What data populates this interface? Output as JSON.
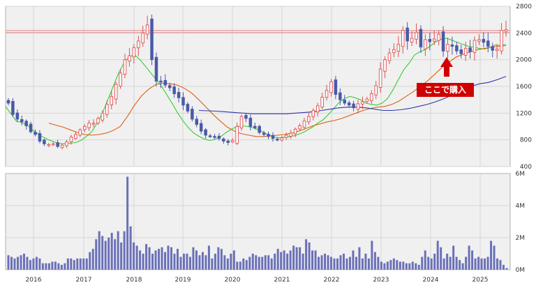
{
  "chart_data": {
    "type": "candlestick",
    "price_panel": {
      "ylim": [
        400,
        2800
      ],
      "y_ticks": [
        "2800",
        "2400",
        "2000",
        "1600",
        "1200",
        "800",
        "400"
      ],
      "x_ticks": [
        "2016",
        "2017",
        "2018",
        "2019",
        "2020",
        "2021",
        "2022",
        "2023",
        "2024",
        "2025"
      ],
      "reference_line": 2420,
      "annotation": "ここで購入",
      "colors": {
        "up": "#e05050",
        "down": "#4a5aa8",
        "ma_short": "#33cc33",
        "ma_mid": "#e06010",
        "ma_long": "#3333aa",
        "ref": "#e08080",
        "annotation_bg": "#d00000"
      },
      "series": {
        "close": [
          1350,
          1180,
          1110,
          1070,
          1010,
          920,
          880,
          780,
          740,
          730,
          740,
          700,
          720,
          770,
          840,
          880,
          950,
          1000,
          1050,
          1050,
          1120,
          1200,
          1330,
          1450,
          1630,
          1800,
          2000,
          2060,
          2180,
          2280,
          2400,
          2520,
          2000,
          1680,
          1670,
          1620,
          1580,
          1490,
          1430,
          1320,
          1230,
          1110,
          1030,
          930,
          870,
          850,
          840,
          820,
          780,
          760,
          790,
          1000,
          1150,
          1120,
          1000,
          980,
          910,
          880,
          850,
          820,
          800,
          830,
          870,
          900,
          960,
          1010,
          1080,
          1150,
          1240,
          1310,
          1440,
          1540,
          1670,
          1480,
          1400,
          1350,
          1320,
          1280,
          1340,
          1370,
          1410,
          1490,
          1610,
          1860,
          2000,
          2100,
          2150,
          2230,
          2440,
          2280,
          2320,
          2410,
          2190,
          2300,
          2270,
          2310,
          2380,
          2130,
          2230,
          2200,
          2130,
          2090,
          2170,
          2120,
          2290,
          2300,
          2260,
          2200,
          2140,
          2160,
          2440,
          2450
        ],
        "ma_short": [
          1300,
          1190,
          1080,
          1060,
          1020,
          950,
          890,
          840,
          800,
          770,
          745,
          740,
          750,
          760,
          790,
          850,
          920,
          1050,
          1200,
          1400,
          1600,
          1800,
          1950,
          2050,
          2070,
          2000,
          1900,
          1800,
          1700,
          1600,
          1470,
          1340,
          1200,
          1080,
          980,
          900,
          850,
          810,
          790,
          810,
          850,
          910,
          960,
          1000,
          1010,
          1000,
          980,
          950,
          910,
          870,
          840,
          830,
          840,
          850,
          870,
          900,
          940,
          990,
          1050,
          1100,
          1180,
          1270,
          1360,
          1420,
          1450,
          1430,
          1400,
          1350,
          1330,
          1320,
          1350,
          1420,
          1550,
          1700,
          1850,
          1950,
          2070,
          2120,
          2150,
          2210,
          2270,
          2310,
          2320,
          2290,
          2260,
          2230,
          2200,
          2190,
          2170,
          2160,
          2180,
          2220,
          2210,
          2230
        ],
        "ma_mid": [
          1050,
          1020,
          990,
          950,
          910,
          880,
          870,
          880,
          900,
          940,
          1000,
          1150,
          1320,
          1460,
          1560,
          1630,
          1650,
          1640,
          1620,
          1570,
          1500,
          1400,
          1290,
          1180,
          1080,
          990,
          930,
          890,
          870,
          850,
          850,
          860,
          870,
          880,
          900,
          930,
          970,
          1010,
          1040,
          1070,
          1090,
          1120,
          1160,
          1200,
          1240,
          1270,
          1290,
          1300,
          1330,
          1380,
          1450,
          1520,
          1600,
          1680,
          1780,
          1880,
          1960,
          2040,
          2080,
          2120,
          2150,
          2170,
          2190,
          2200,
          2210
        ],
        "ma_long": [
          1240,
          1235,
          1230,
          1220,
          1210,
          1200,
          1190,
          1190,
          1190,
          1190,
          1190,
          1200,
          1210,
          1220,
          1240,
          1260,
          1280,
          1290,
          1290,
          1280,
          1260,
          1240,
          1240,
          1250,
          1270,
          1300,
          1330,
          1370,
          1420,
          1480,
          1540,
          1600,
          1640,
          1660,
          1700,
          1750
        ]
      }
    },
    "volume_panel": {
      "ylim": [
        0,
        6000000
      ],
      "y_ticks": [
        "6M",
        "4M",
        "2M",
        "0M"
      ],
      "color": "#6a70b8",
      "values": [
        900000,
        800000,
        700000,
        800000,
        900000,
        1000000,
        800000,
        600000,
        700000,
        800000,
        700000,
        400000,
        400000,
        400000,
        500000,
        500000,
        400000,
        300000,
        400000,
        700000,
        700000,
        600000,
        700000,
        700000,
        700000,
        700000,
        1100000,
        1300000,
        1900000,
        2400000,
        2100000,
        1800000,
        2000000,
        2300000,
        1900000,
        2400000,
        1700000,
        2400000,
        5800000,
        2700000,
        1700000,
        1500000,
        1200000,
        1000000,
        1600000,
        1400000,
        1000000,
        1200000,
        1300000,
        1400000,
        1100000,
        1500000,
        1400000,
        1000000,
        1300000,
        800000,
        1000000,
        1000000,
        800000,
        1400000,
        1200000,
        900000,
        1100000,
        900000,
        1500000,
        700000,
        1000000,
        1400000,
        1300000,
        900000,
        700000,
        1000000,
        1200000,
        500000,
        500000,
        700000,
        600000,
        800000,
        1000000,
        900000,
        800000,
        800000,
        900000,
        900000,
        700000,
        1000000,
        1300000,
        1100000,
        1200000,
        1000000,
        1200000,
        1500000,
        1400000,
        1400000,
        1000000,
        1900000,
        1700000,
        1200000,
        1200000,
        800000,
        900000,
        1000000,
        900000,
        800000,
        700000,
        700000,
        900000,
        1000000,
        700000,
        800000,
        1200000,
        800000,
        1400000,
        700000,
        1000000,
        700000,
        1800000,
        1100000,
        800000,
        500000,
        400000,
        500000,
        600000,
        700000,
        600000,
        500000,
        500000,
        400000,
        400000,
        500000,
        400000,
        300000,
        800000,
        1200000,
        800000,
        700000,
        1000000,
        1800000,
        1400000,
        700000,
        1000000,
        800000,
        1500000,
        800000,
        600000,
        400000,
        800000,
        1500000,
        1200000,
        700000,
        800000,
        700000,
        700000,
        800000,
        1800000,
        1500000,
        700000,
        600000,
        300000,
        100000
      ]
    }
  }
}
